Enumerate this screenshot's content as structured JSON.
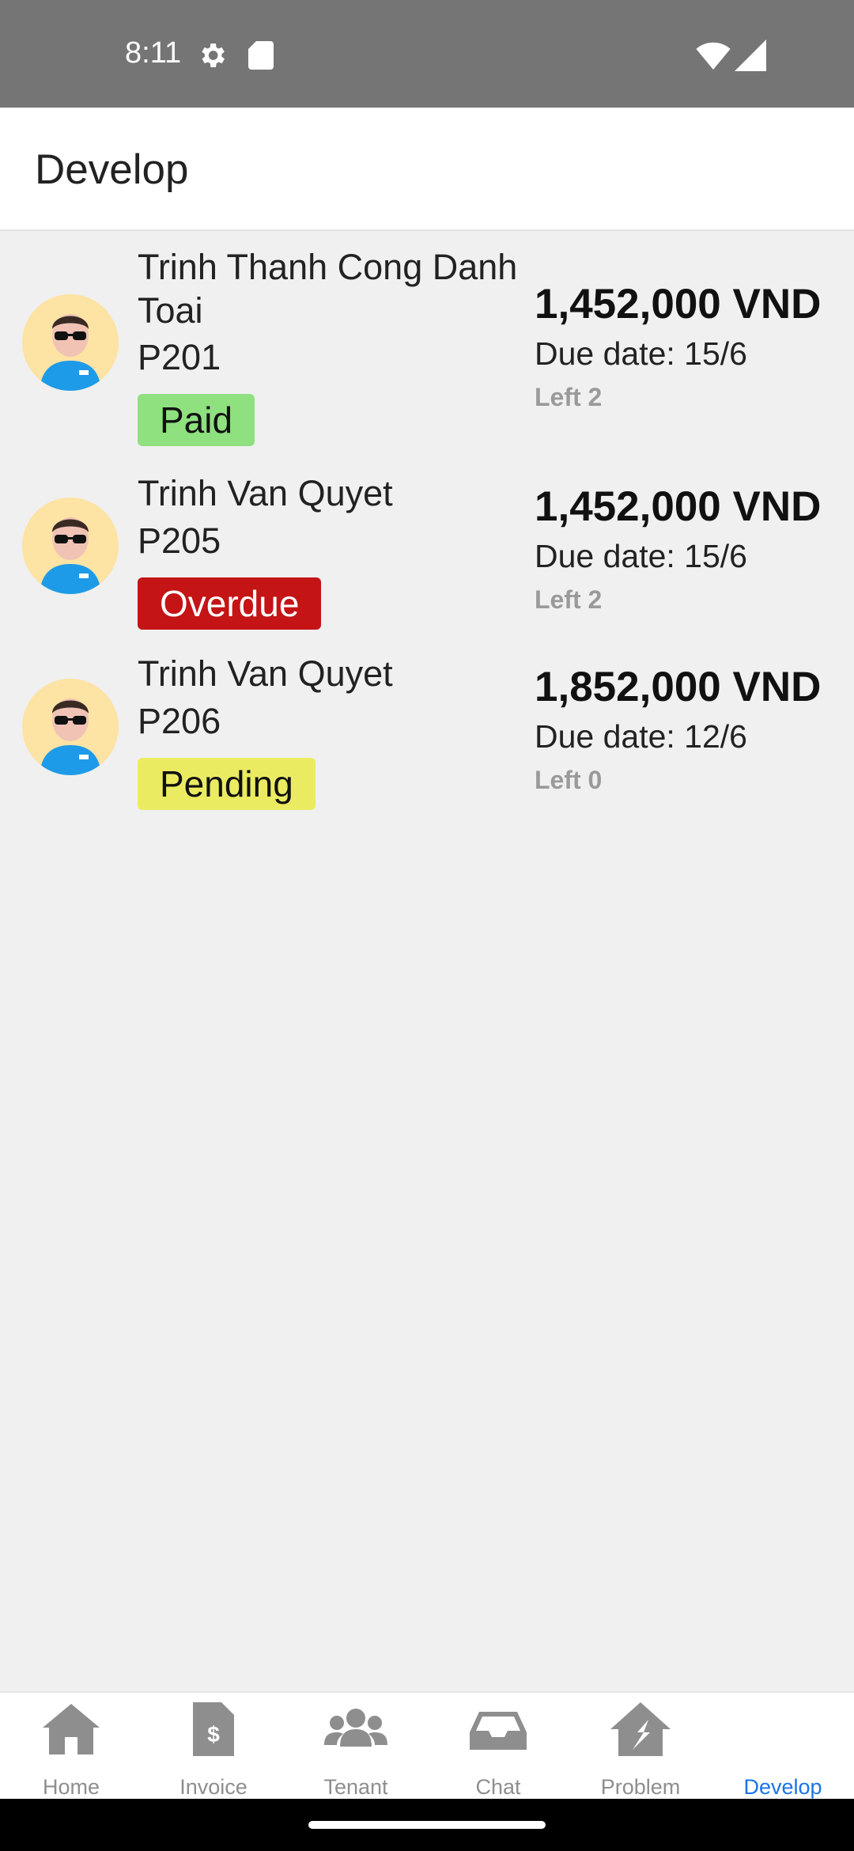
{
  "status_bar": {
    "time": "8:11"
  },
  "header": {
    "title": "Develop"
  },
  "invoices": [
    {
      "name": "Trinh Thanh Cong Danh Toai",
      "room": "P201",
      "status": "Paid",
      "amount": "1,452,000 VND",
      "due": "Due date: 15/6",
      "left": "Left 2"
    },
    {
      "name": "Trinh Van Quyet",
      "room": "P205",
      "status": "Overdue",
      "amount": "1,452,000 VND",
      "due": "Due date: 15/6",
      "left": "Left 2"
    },
    {
      "name": "Trinh Van Quyet",
      "room": "P206",
      "status": "Pending",
      "amount": "1,852,000 VND",
      "due": "Due date: 12/6",
      "left": "Left 0"
    }
  ],
  "status_colors": {
    "paid": "#8fe07f",
    "overdue": "#c41416",
    "pending": "#ebeb62"
  },
  "nav": {
    "items": [
      {
        "label": "Home",
        "icon": "home-icon"
      },
      {
        "label": "Invoice",
        "icon": "invoice-icon"
      },
      {
        "label": "Tenant",
        "icon": "users-icon"
      },
      {
        "label": "Chat",
        "icon": "inbox-icon"
      },
      {
        "label": "Problem",
        "icon": "house-repair-icon"
      },
      {
        "label": "Develop",
        "icon": "develop-icon"
      }
    ],
    "active": "Develop",
    "active_color": "#1a73e8"
  }
}
